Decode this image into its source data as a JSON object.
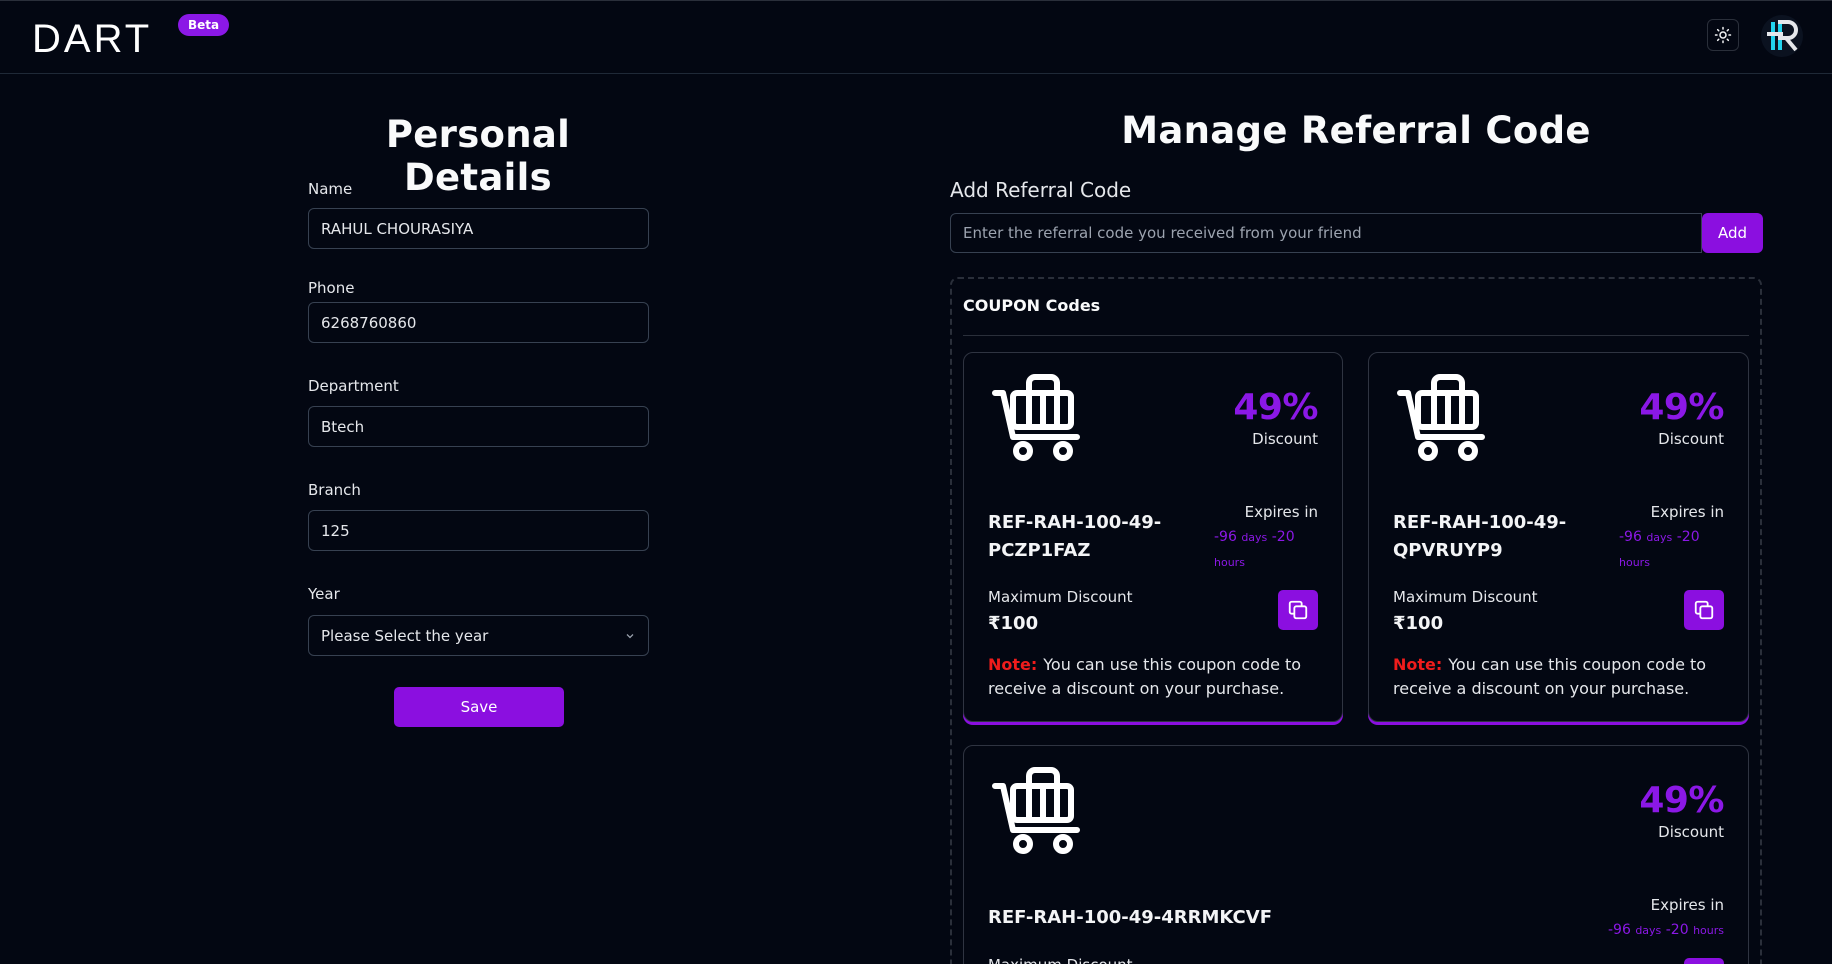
{
  "header": {
    "logo_text": "DART",
    "beta_badge": "Beta",
    "theme_icon": "sun-icon",
    "avatar_icon": "r-logo-icon"
  },
  "personal_details": {
    "title": "Personal Details",
    "name_label": "Name",
    "name_value": "RAHUL CHOURASIYA",
    "phone_label": "Phone",
    "phone_value": "6268760860",
    "department_label": "Department",
    "department_value": "Btech",
    "branch_label": "Branch",
    "branch_value": "125",
    "year_label": "Year",
    "year_selected": "Please Select the year",
    "save_label": "Save"
  },
  "referral": {
    "title": "Manage Referral Code",
    "add_label": "Add Referral Code",
    "input_placeholder": "Enter the referral code you received from your friend",
    "add_button": "Add",
    "coupons_heading": "COUPON Codes"
  },
  "coupons": [
    {
      "percent": "49%",
      "discount_label": "Discount",
      "code": "REF-RAH-100-49-PCZP1FAZ",
      "expires_label": "Expires in",
      "expires_days": "-96",
      "days_unit": "days",
      "expires_hours": "-20",
      "hours_unit": "hours",
      "max_label": "Maximum Discount",
      "max_value": "₹100",
      "note_label": "Note:",
      "note_text": "You can use this coupon code to receive a discount on your purchase."
    },
    {
      "percent": "49%",
      "discount_label": "Discount",
      "code": "REF-RAH-100-49-QPVRUYP9",
      "expires_label": "Expires in",
      "expires_days": "-96",
      "days_unit": "days",
      "expires_hours": "-20",
      "hours_unit": "hours",
      "max_label": "Maximum Discount",
      "max_value": "₹100",
      "note_label": "Note:",
      "note_text": "You can use this coupon code to receive a discount on your purchase."
    },
    {
      "percent": "49%",
      "discount_label": "Discount",
      "code": "REF-RAH-100-49-4RRMKCVF",
      "expires_label": "Expires in",
      "expires_days": "-96",
      "days_unit": "days",
      "expires_hours": "-20",
      "hours_unit": "hours",
      "max_label": "Maximum Discount"
    }
  ],
  "colors": {
    "accent": "#8b0fe0",
    "background": "#030712",
    "note_red": "#ef1c1c"
  }
}
